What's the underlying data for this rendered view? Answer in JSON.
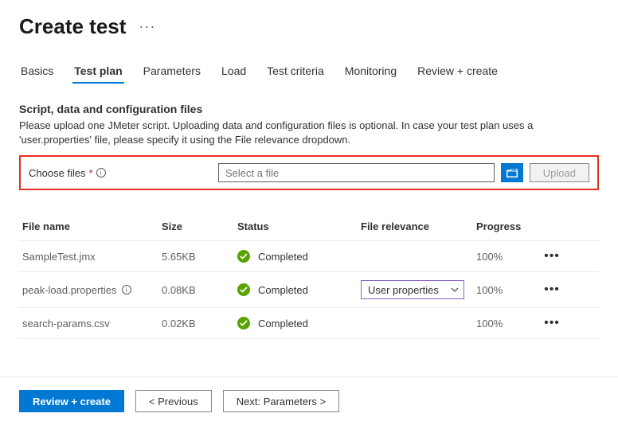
{
  "header": {
    "title": "Create test"
  },
  "tabs": [
    "Basics",
    "Test plan",
    "Parameters",
    "Load",
    "Test criteria",
    "Monitoring",
    "Review + create"
  ],
  "active_tab_index": 1,
  "section": {
    "title": "Script, data and configuration files",
    "description": "Please upload one JMeter script. Uploading data and configuration files is optional. In case your test plan uses a 'user.properties' file, please specify it using the File relevance dropdown."
  },
  "choose_files": {
    "label": "Choose files",
    "placeholder": "Select a file",
    "upload_label": "Upload"
  },
  "columns": {
    "name": "File name",
    "size": "Size",
    "status": "Status",
    "relevance": "File relevance",
    "progress": "Progress"
  },
  "files": [
    {
      "name": "SampleTest.jmx",
      "info": false,
      "size": "5.65KB",
      "status": "Completed",
      "relevance": "",
      "progress": "100%"
    },
    {
      "name": "peak-load.properties",
      "info": true,
      "size": "0.08KB",
      "status": "Completed",
      "relevance": "User properties",
      "progress": "100%"
    },
    {
      "name": "search-params.csv",
      "info": false,
      "size": "0.02KB",
      "status": "Completed",
      "relevance": "",
      "progress": "100%"
    }
  ],
  "footer": {
    "review": "Review + create",
    "previous": "< Previous",
    "next": "Next: Parameters >"
  }
}
